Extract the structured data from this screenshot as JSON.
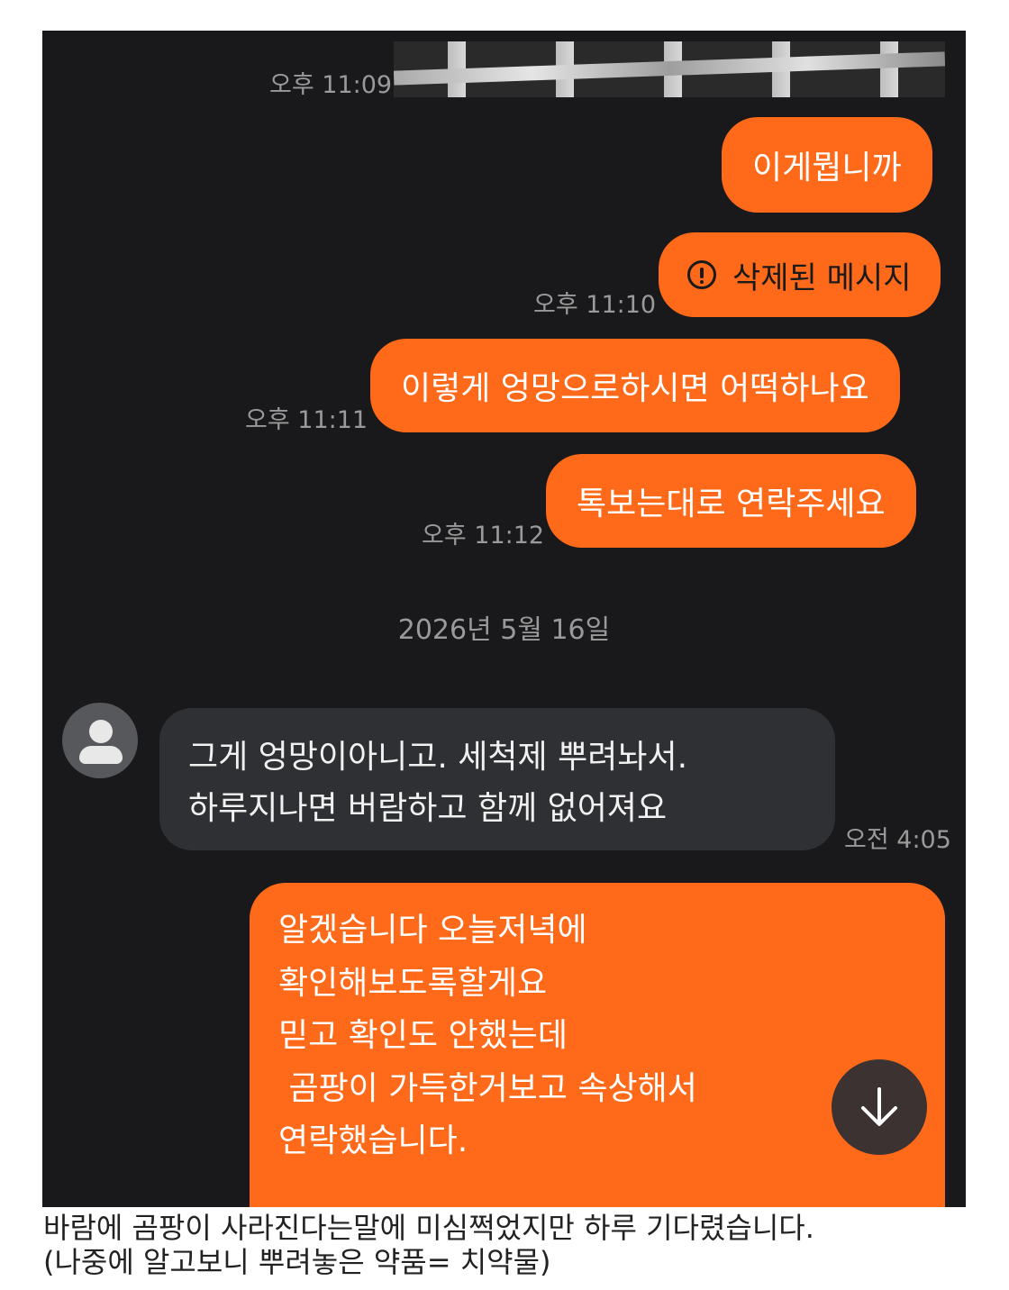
{
  "chat": {
    "messages": [
      {
        "time": "오후 11:09"
      },
      {
        "text": "이게뭡니까"
      },
      {
        "text": "삭제된 메시지",
        "time": "오후 11:10",
        "deleted": true
      },
      {
        "text": "이렇게 엉망으로하시면 어떡하나요",
        "time": "오후 11:11"
      },
      {
        "text": "톡보는대로 연락주세요",
        "time": "오후 11:12"
      }
    ],
    "date_separator": "2026년 5월 16일",
    "incoming": {
      "line1": "그게 엉망이아니고. 세척제 뿌려놔서.",
      "line2": "하루지나면 버람하고 함께 없어져요",
      "time": "오전 4:05"
    },
    "reply": {
      "lines": [
        "알겠습니다 오늘저녁에",
        "확인해보도록할게요",
        "믿고 확인도 안했는데",
        " 곰팡이 가득한거보고 속상해서",
        "연락했습니다."
      ]
    },
    "scroll_icon": "arrow-down-icon"
  },
  "colors": {
    "background": "#19191b",
    "outgoing_bubble": "#ff6a1a",
    "incoming_bubble": "#2f3033",
    "timestamp": "#9a9a9a"
  },
  "caption": {
    "line1": "바람에 곰팡이 사라진다는말에 미심쩍었지만 하루 기다렸습니다.",
    "line2": "(나중에 알고보니 뿌려놓은 약품= 치약물)"
  }
}
